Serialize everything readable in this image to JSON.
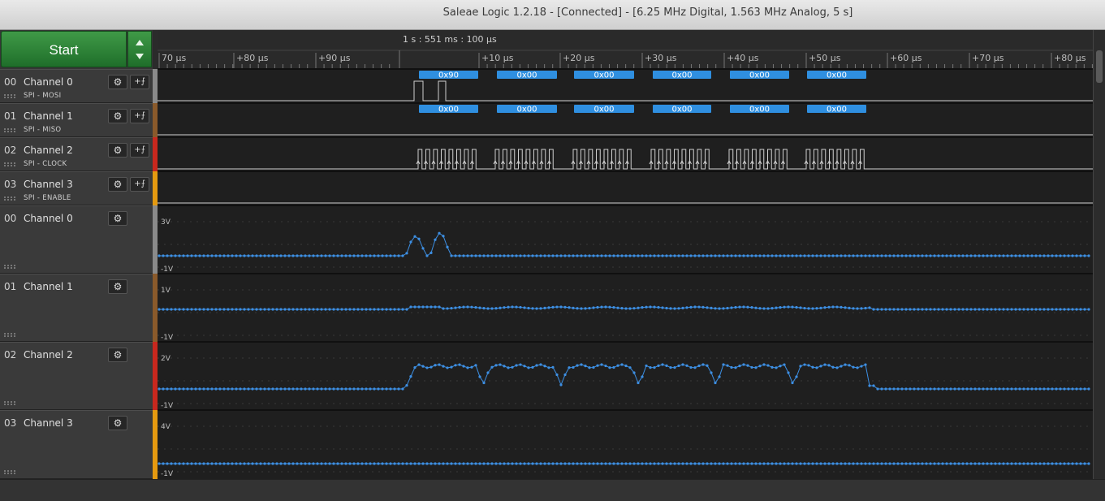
{
  "window": {
    "title": "Saleae Logic 1.2.18 - [Connected] - [6.25 MHz Digital, 1.563 MHz Analog, 5 s]"
  },
  "start": {
    "label": "Start"
  },
  "timeline": {
    "header": "1 s : 551 ms : 100 µs",
    "ticks": [
      "70 µs",
      "+80 µs",
      "+90 µs",
      "+10 µs",
      "+20 µs",
      "+30 µs",
      "+40 µs",
      "+50 µs",
      "+60 µs",
      "+70 µs",
      "+80 µs"
    ]
  },
  "digital_channels": [
    {
      "num": "00",
      "name": "Channel 0",
      "sub": "SPI - MOSI",
      "color": "#8a8a8a"
    },
    {
      "num": "01",
      "name": "Channel 1",
      "sub": "SPI - MISO",
      "color": "#8a5a2b"
    },
    {
      "num": "02",
      "name": "Channel 2",
      "sub": "SPI - CLOCK",
      "color": "#c8281e"
    },
    {
      "num": "03",
      "name": "Channel 3",
      "sub": "SPI - ENABLE",
      "color": "#e59a10"
    }
  ],
  "analog_channels": [
    {
      "num": "00",
      "name": "Channel 0",
      "vtop": "3V",
      "vbot": "-1V",
      "color": "#8a8a8a"
    },
    {
      "num": "01",
      "name": "Channel 1",
      "vtop": "1V",
      "vbot": "-1V",
      "color": "#8a5a2b"
    },
    {
      "num": "02",
      "name": "Channel 2",
      "vtop": "2V",
      "vbot": "-1V",
      "color": "#c8281e"
    },
    {
      "num": "03",
      "name": "Channel 3",
      "vtop": "4V",
      "vbot": "-1V",
      "color": "#e59a10"
    }
  ],
  "decodes": {
    "mosi": [
      "0x90",
      "0x00",
      "0x00",
      "0x00",
      "0x00",
      "0x00"
    ],
    "miso": [
      "0x00",
      "0x00",
      "0x00",
      "0x00",
      "0x00",
      "0x00"
    ]
  },
  "colors": {
    "decode": "#2f8fe0",
    "trace": "#cfcfcf",
    "analog": "#3d8fe3",
    "background": "#1f1f1f"
  },
  "icons": {
    "settings": "gear-icon",
    "trigger": "trigger-icon"
  }
}
